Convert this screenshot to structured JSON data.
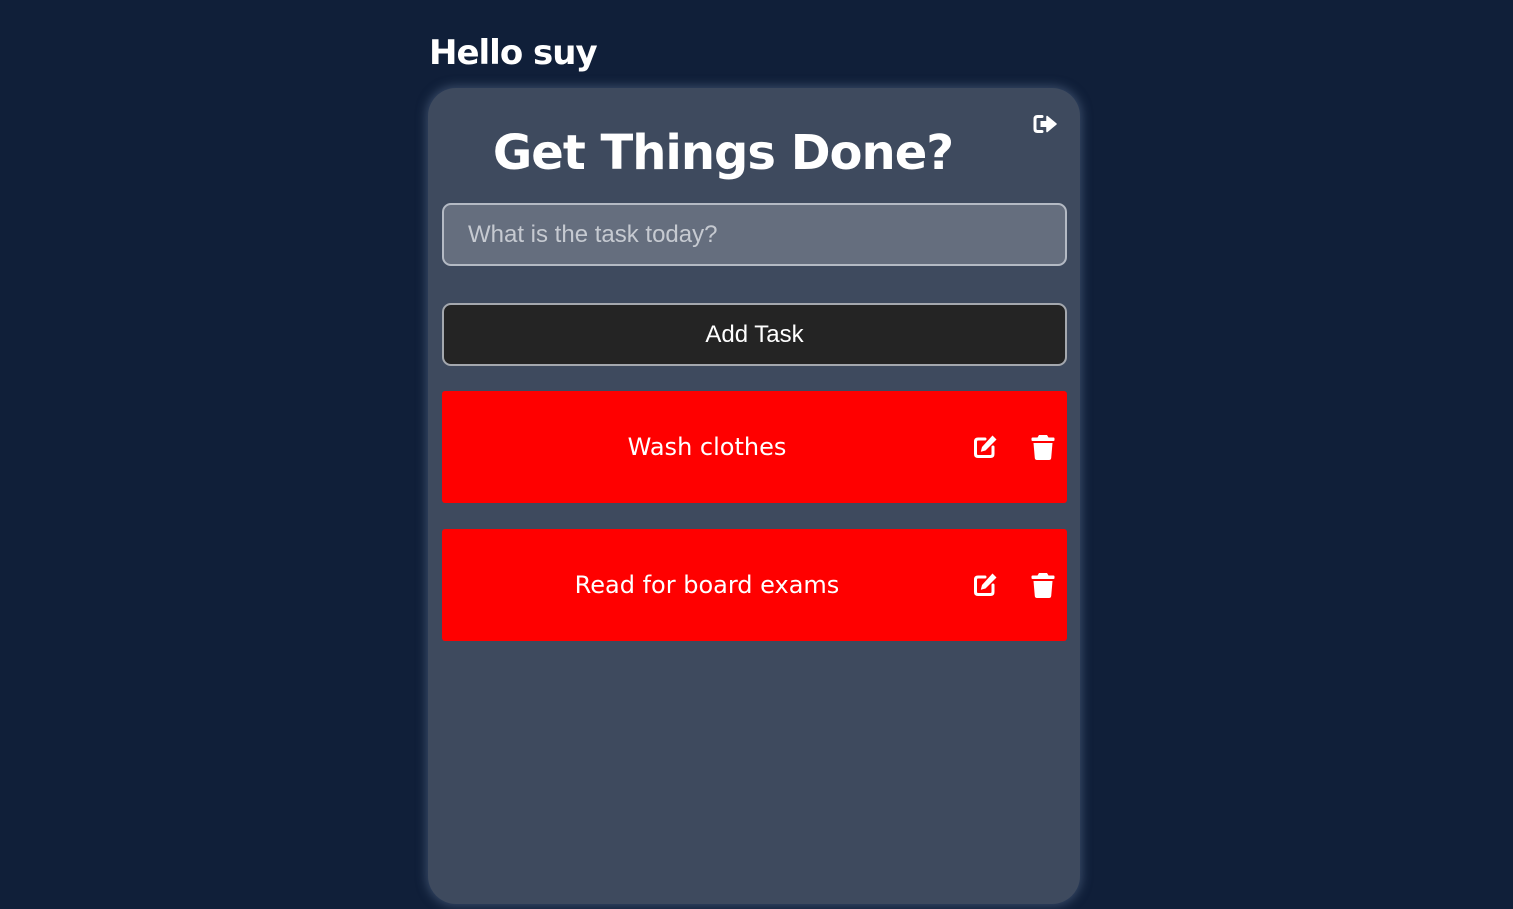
{
  "header": {
    "greeting": "Hello suy"
  },
  "app": {
    "title": "Get Things Done?",
    "logout_icon": "logout-icon"
  },
  "form": {
    "input_placeholder": "What is the task today?",
    "input_value": "",
    "add_button_label": "Add Task"
  },
  "tasks": [
    {
      "text": "Wash clothes",
      "edit_icon": "edit-icon",
      "delete_icon": "trash-icon"
    },
    {
      "text": "Read for board exams",
      "edit_icon": "edit-icon",
      "delete_icon": "trash-icon"
    }
  ],
  "colors": {
    "page_background": "#101f39",
    "card_background": "#3e4a5e",
    "task_background": "#ff0000",
    "button_background": "#242424",
    "input_background": "#656e7e"
  }
}
